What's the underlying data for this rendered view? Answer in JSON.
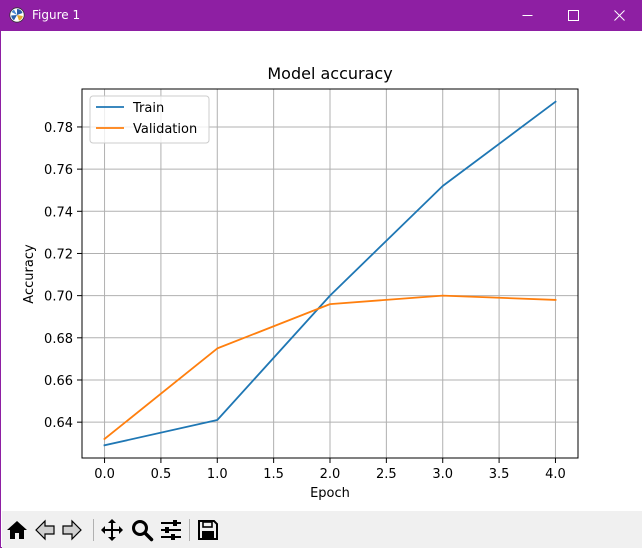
{
  "window": {
    "title": "Figure 1",
    "titlebar_color": "#8e1fa3",
    "controls": [
      "minimize-icon",
      "maximize-icon",
      "close-icon"
    ]
  },
  "toolbar": {
    "buttons": [
      "home-icon",
      "back-icon",
      "forward-icon",
      "pan-icon",
      "zoom-icon",
      "configure-subplots-icon",
      "save-icon"
    ]
  },
  "chart_data": {
    "type": "line",
    "title": "Model accuracy",
    "xlabel": "Epoch",
    "ylabel": "Accuracy",
    "x": [
      0,
      1,
      2,
      3,
      4
    ],
    "xlim": [
      -0.2,
      4.2
    ],
    "ylim": [
      0.623,
      0.798
    ],
    "xticks": [
      0.0,
      0.5,
      1.0,
      1.5,
      2.0,
      2.5,
      3.0,
      3.5,
      4.0
    ],
    "xtick_labels": [
      "0.0",
      "0.5",
      "1.0",
      "1.5",
      "2.0",
      "2.5",
      "3.0",
      "3.5",
      "4.0"
    ],
    "yticks": [
      0.64,
      0.66,
      0.68,
      0.7,
      0.72,
      0.74,
      0.76,
      0.78
    ],
    "ytick_labels": [
      "0.64",
      "0.66",
      "0.68",
      "0.70",
      "0.72",
      "0.74",
      "0.76",
      "0.78"
    ],
    "grid": true,
    "legend_position": "top-left",
    "series": [
      {
        "name": "Train",
        "color": "#1f77b4",
        "values": [
          0.629,
          0.641,
          0.7,
          0.752,
          0.792
        ]
      },
      {
        "name": "Validation",
        "color": "#ff7f0e",
        "values": [
          0.632,
          0.675,
          0.696,
          0.7,
          0.698
        ]
      }
    ]
  }
}
